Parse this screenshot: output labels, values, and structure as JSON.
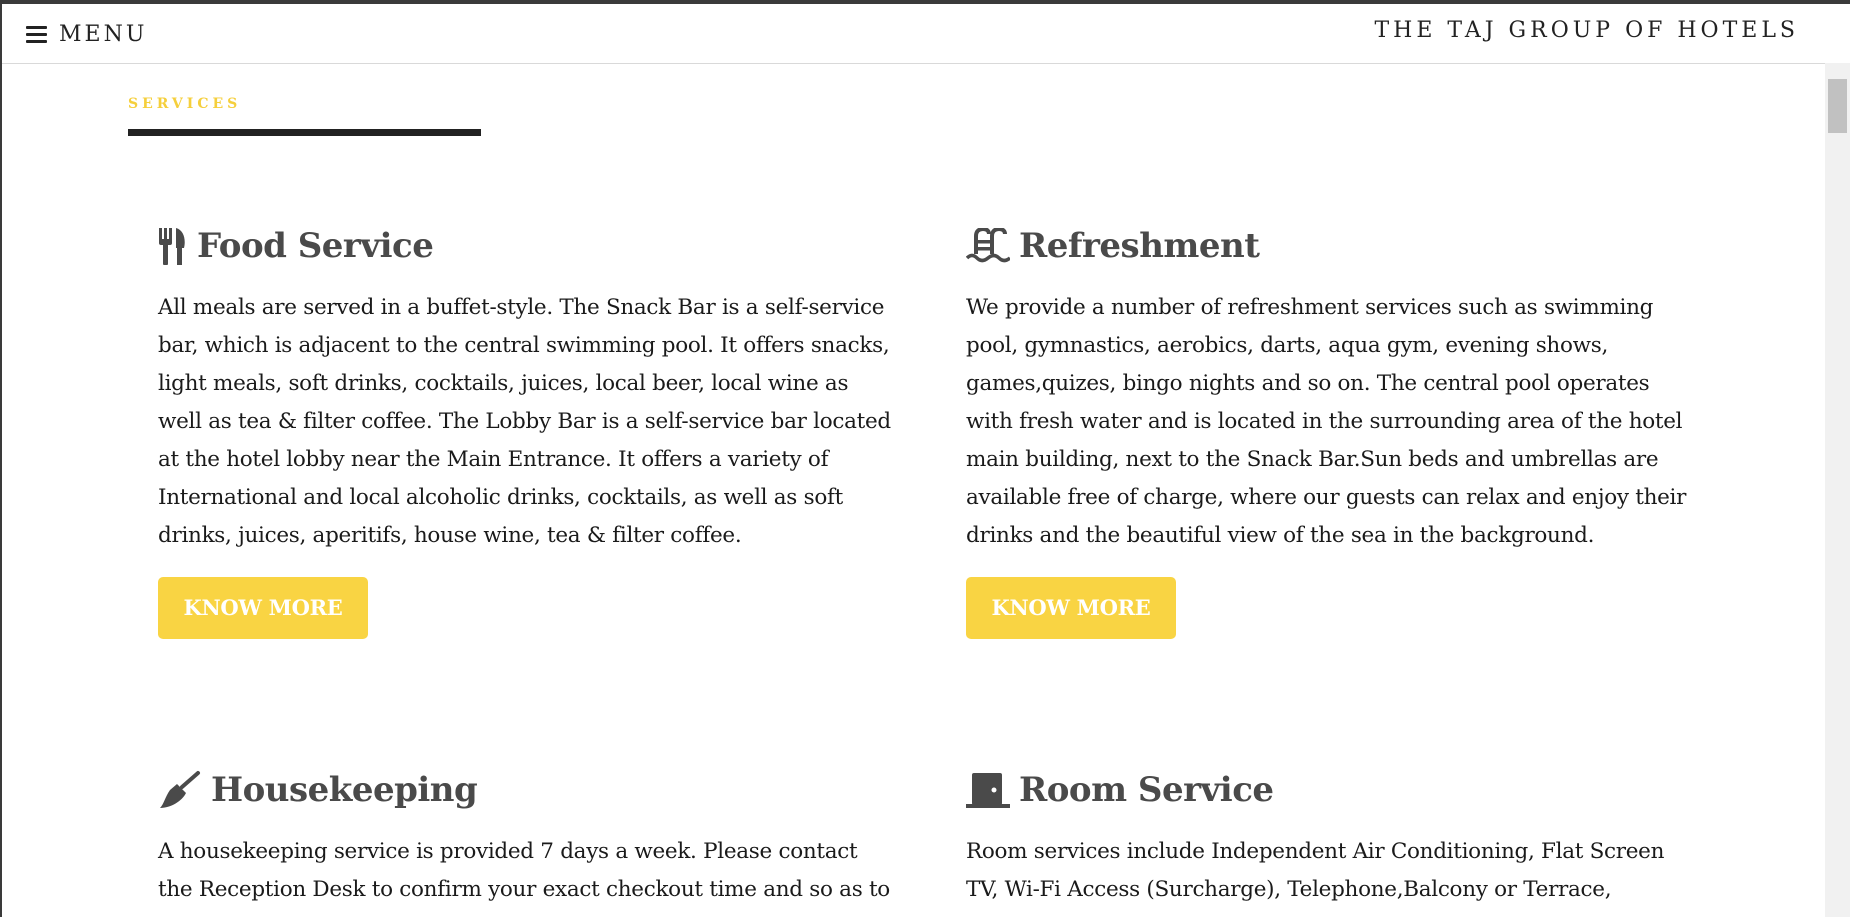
{
  "header": {
    "menu_label": "MENU",
    "brand": "THE TAJ GROUP OF HOTELS"
  },
  "section": {
    "title": "SERVICES"
  },
  "cards": [
    {
      "icon": "utensils-icon",
      "title": "Food Service",
      "text": "All meals are served in a buffet-style. The Snack Bar is a self-service bar, which is adjacent to the central swimming pool. It offers snacks, light meals, soft drinks, cocktails, juices, local beer, local wine as well as tea & filter coffee. The Lobby Bar is a self-service bar located at the hotel lobby near the Main Entrance. It offers a variety of International and local alcoholic drinks, cocktails, as well as soft drinks, juices, aperitifs, house wine, tea & filter coffee.",
      "button": "KNOW MORE"
    },
    {
      "icon": "swimming-pool-icon",
      "title": "Refreshment",
      "text": "We provide a number of refreshment services such as swimming pool, gymnastics, aerobics, darts, aqua gym, evening shows, games,quizes, bingo nights and so on. The central pool operates with fresh water and is located in the surrounding area of the hotel main building, next to the Snack Bar.Sun beds and umbrellas are available free of charge, where our guests can relax and enjoy their drinks and the beautiful view of the sea in the background.",
      "button": "KNOW MORE"
    },
    {
      "icon": "broom-icon",
      "title": "Housekeeping",
      "text": "A housekeeping service is provided 7 days a week. Please contact the Reception Desk to confirm your exact checkout time and so as to"
    },
    {
      "icon": "door-icon",
      "title": "Room Service",
      "text": "Room services include Independent Air Conditioning, Flat Screen TV, Wi-Fi Access (Surcharge), Telephone,Balcony or Terrace,"
    }
  ],
  "colors": {
    "accent": "#f9d443",
    "heading": "#4a4a4a",
    "text": "#1a1a1a"
  }
}
